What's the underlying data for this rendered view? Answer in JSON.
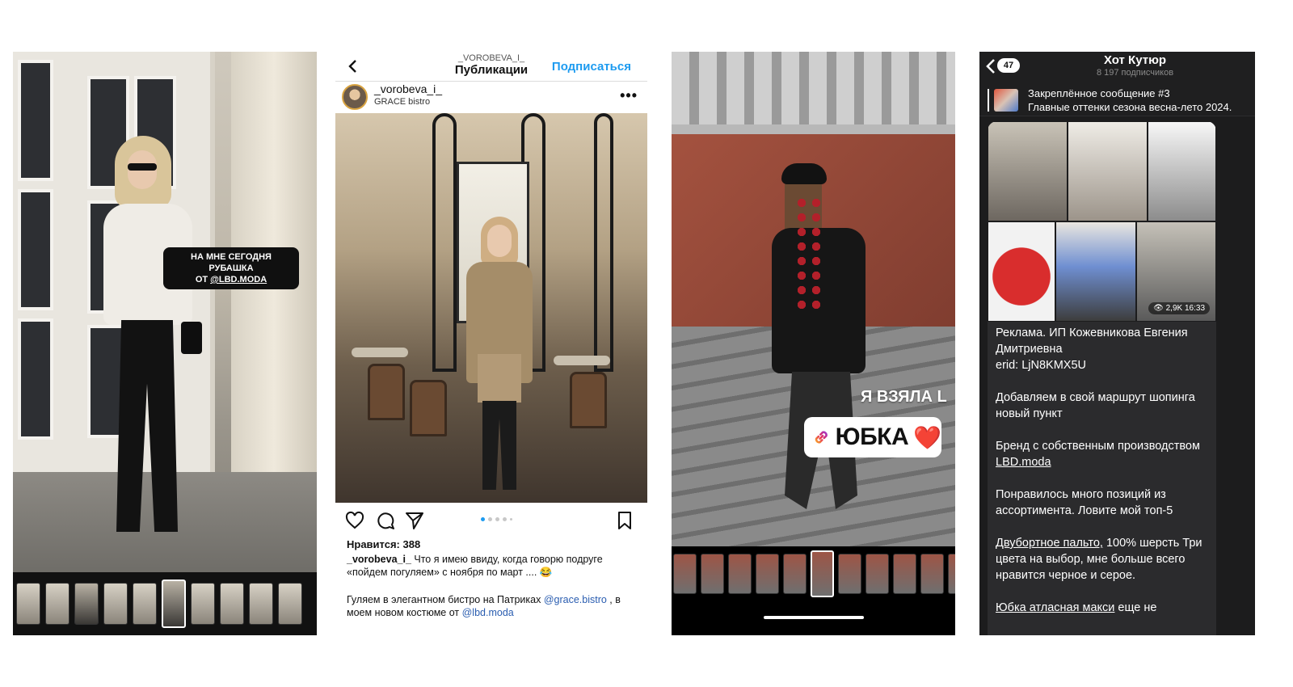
{
  "story1": {
    "sticker_line1": "НА МНЕ СЕГОДНЯ РУБАШКА",
    "sticker_line2_prefix": "ОТ ",
    "sticker_mention": "@LBD.MODA"
  },
  "instagram": {
    "header_username": "_VOROBEVA_I_",
    "header_title": "Публикации",
    "subscribe_label": "Подписаться",
    "author": "_vorobeva_i_",
    "location": "GRACE bistro",
    "likes": "Нравится: 388",
    "caption_author": "_vorobeva_i_",
    "caption_text": " Что я имею ввиду, когда говорю подруге «пойдем погуляем» с ноября по март .... 😂",
    "caption2_prefix": "Гуляем в элегантном бистро на Патриках ",
    "caption2_mention1": "@grace.bistro",
    "caption2_middle": " , в моем новом костюме от ",
    "caption2_mention2": "@lbd.moda",
    "accent_color": "#1d9bf0",
    "carousel_position": 1,
    "carousel_count": 5
  },
  "story2": {
    "caption": "Я ВЗЯЛА L",
    "link_text": "ЮБКА",
    "heart": "❤️"
  },
  "telegram": {
    "back_badge": "47",
    "channel_title": "Хот Кутюр",
    "subscribers": "8 197 подписчиков",
    "pinned_title": "Закреплённое сообщение #3",
    "pinned_text": "Главные оттенки сезона весна-лето 2024.",
    "views": "2,9K 16:33",
    "ad_line": "Реклама. ИП Кожевникова Евгения Дмитриевна",
    "erid": "erid: LjN8KMX5U",
    "para1": "Добавляем в свой маршрут шопинга новый пункт",
    "para2_prefix": "Бренд с собственным производством ",
    "para2_link": "LBD.moda ",
    "para3": "Понравилось много позиций из ассортимента. Ловите мой топ-5",
    "para4_link": "Двубортное пальто,",
    "para4_text": " 100% шерсть Три цвета на выбор, мне больше всего нравится черное и серое.",
    "para5_link": "Юбка атласная макси",
    "para5_text": " еще не"
  }
}
